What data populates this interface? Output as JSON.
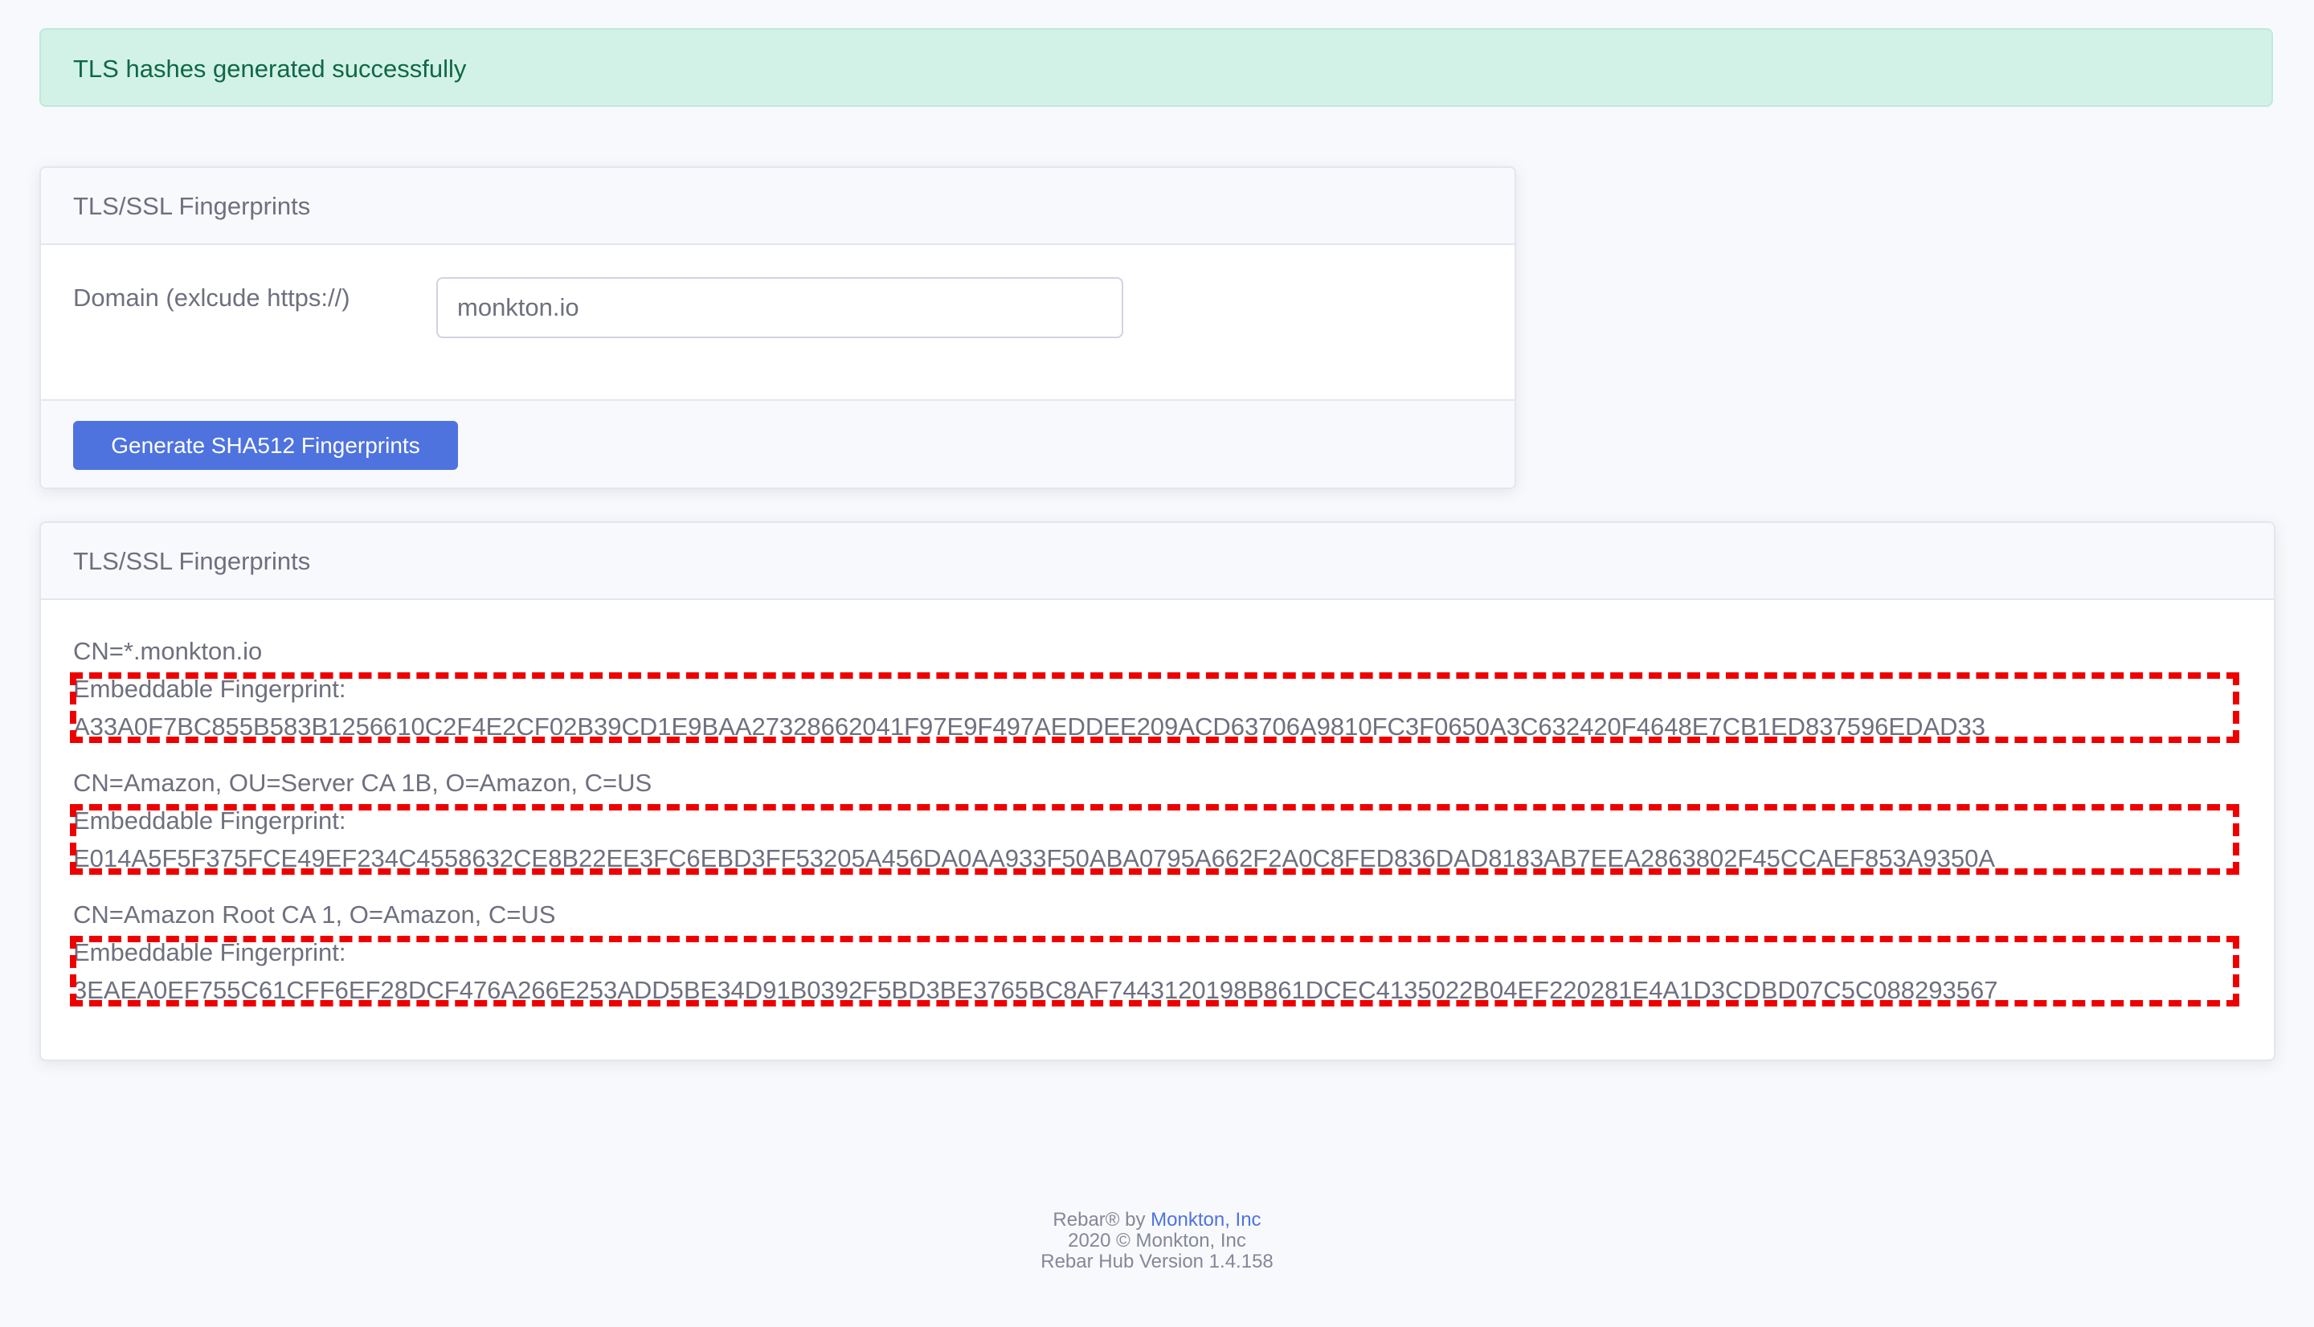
{
  "alert": {
    "message": "TLS hashes generated successfully"
  },
  "form_card": {
    "title": "TLS/SSL Fingerprints",
    "domain_label": "Domain (exlcude https://)",
    "domain_value": "monkton.io",
    "generate_button": "Generate SHA512 Fingerprints"
  },
  "results_card": {
    "title": "TLS/SSL Fingerprints",
    "certificates": [
      {
        "subject": "CN=*.monkton.io",
        "fingerprint_label": "Embeddable Fingerprint:",
        "fingerprint": "A33A0F7BC855B583B1256610C2F4E2CF02B39CD1E9BAA27328662041F97E9F497AEDDEE209ACD63706A9810FC3F0650A3C632420F4648E7CB1ED837596EDAD33"
      },
      {
        "subject": "CN=Amazon, OU=Server CA 1B, O=Amazon, C=US",
        "fingerprint_label": "Embeddable Fingerprint:",
        "fingerprint": "E014A5F5F375FCE49EF234C4558632CE8B22EE3FC6EBD3FF53205A456DA0AA933F50ABA0795A662F2A0C8FED836DAD8183AB7EEA2863802F45CCAEF853A9350A"
      },
      {
        "subject": "CN=Amazon Root CA 1, O=Amazon, C=US",
        "fingerprint_label": "Embeddable Fingerprint:",
        "fingerprint": "3EAEA0EF755C61CFF6EF28DCF476A266E253ADD5BE34D91B0392F5BD3BE3765BC8AF7443120198B861DCEC4135022B04EF220281E4A1D3CDBD07C5C088293567"
      }
    ],
    "highlight_color": "#ee0000"
  },
  "footer": {
    "brand_prefix": "Rebar® by ",
    "brand_link": "Monkton, Inc",
    "copyright": "2020 ©  Monkton, Inc",
    "version": "Rebar Hub Version 1.4.158"
  },
  "colors": {
    "primary": "#4e73df",
    "success_bg": "#d3f2e7",
    "success_text": "#0f6848"
  }
}
